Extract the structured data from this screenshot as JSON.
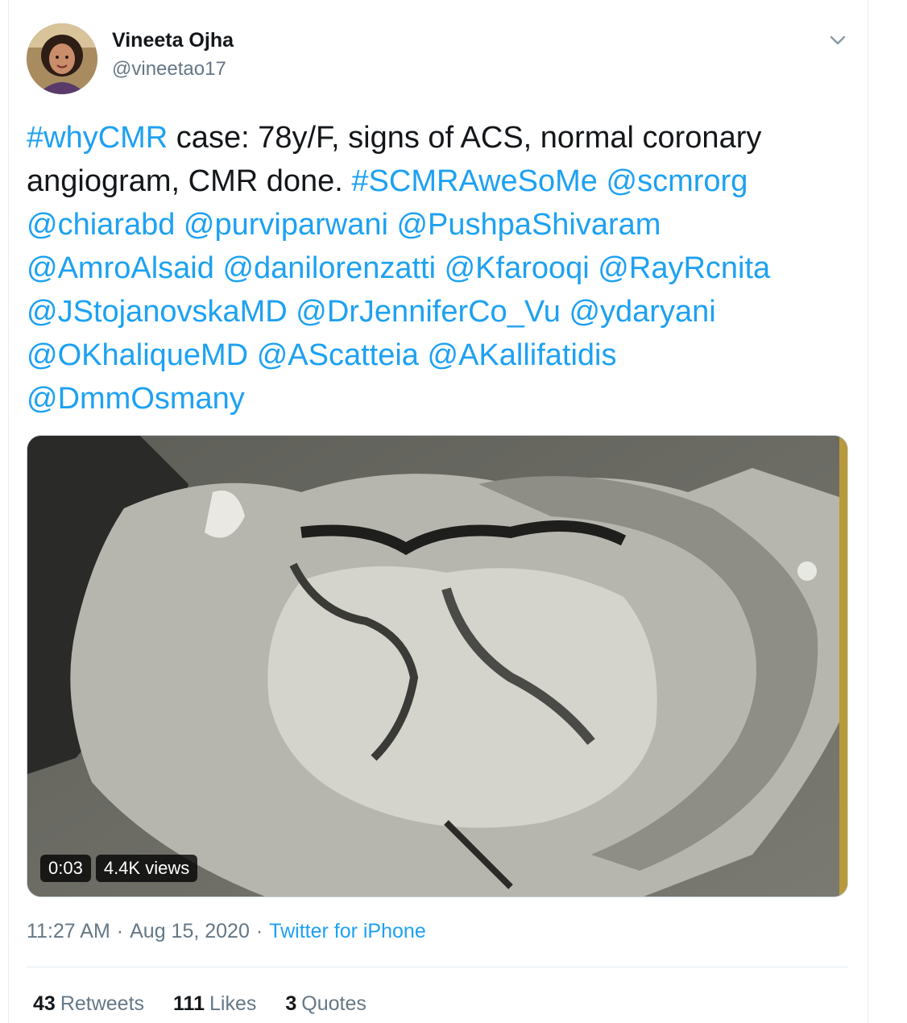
{
  "author": {
    "name": "Vineeta Ojha",
    "handle": "@vineetao17",
    "avatar": "avatar-photo"
  },
  "menu": {
    "icon": "chevron-down-icon"
  },
  "tweet": {
    "segments": [
      {
        "text": "#whyCMR",
        "link": true
      },
      {
        "text": " case: 78y/F, signs of ACS, normal coronary angiogram, CMR done. ",
        "link": false
      },
      {
        "text": "#SCMRAweSoMe",
        "link": true
      },
      {
        "text": " ",
        "link": false
      },
      {
        "text": "@scmrorg",
        "link": true
      },
      {
        "text": " ",
        "link": false
      },
      {
        "text": "@chiarabd",
        "link": true
      },
      {
        "text": " ",
        "link": false
      },
      {
        "text": "@purviparwani",
        "link": true
      },
      {
        "text": " ",
        "link": false
      },
      {
        "text": "@PushpaShivaram",
        "link": true
      },
      {
        "text": " ",
        "link": false
      },
      {
        "text": "@AmroAlsaid",
        "link": true
      },
      {
        "text": " ",
        "link": false
      },
      {
        "text": "@danilorenzatti",
        "link": true
      },
      {
        "text": " ",
        "link": false
      },
      {
        "text": "@Kfarooqi",
        "link": true
      },
      {
        "text": " ",
        "link": false
      },
      {
        "text": "@RayRcnita",
        "link": true
      },
      {
        "text": " ",
        "link": false
      },
      {
        "text": "@JStojanovskaMD",
        "link": true
      },
      {
        "text": " ",
        "link": false
      },
      {
        "text": "@DrJenniferCo_Vu",
        "link": true
      },
      {
        "text": " ",
        "link": false
      },
      {
        "text": "@ydaryani",
        "link": true
      },
      {
        "text": " ",
        "link": false
      },
      {
        "text": "@OKhaliqueMD",
        "link": true
      },
      {
        "text": " ",
        "link": false
      },
      {
        "text": "@AScatteia",
        "link": true
      },
      {
        "text": " ",
        "link": false
      },
      {
        "text": "@AKallifatidis",
        "link": true
      },
      {
        "text": " ",
        "link": false
      },
      {
        "text": "@DmmOsmany",
        "link": true
      }
    ]
  },
  "video": {
    "duration": "0:03",
    "views": "4.4K views"
  },
  "meta": {
    "time": "11:27 AM",
    "date": "Aug 15, 2020",
    "source": "Twitter for iPhone",
    "separator": "·"
  },
  "stats": {
    "retweets_count": "43",
    "retweets_label": "Retweets",
    "likes_count": "111",
    "likes_label": "Likes",
    "quotes_count": "3",
    "quotes_label": "Quotes"
  },
  "colors": {
    "link": "#1da1f2",
    "text": "#14171a",
    "muted": "#657786"
  }
}
